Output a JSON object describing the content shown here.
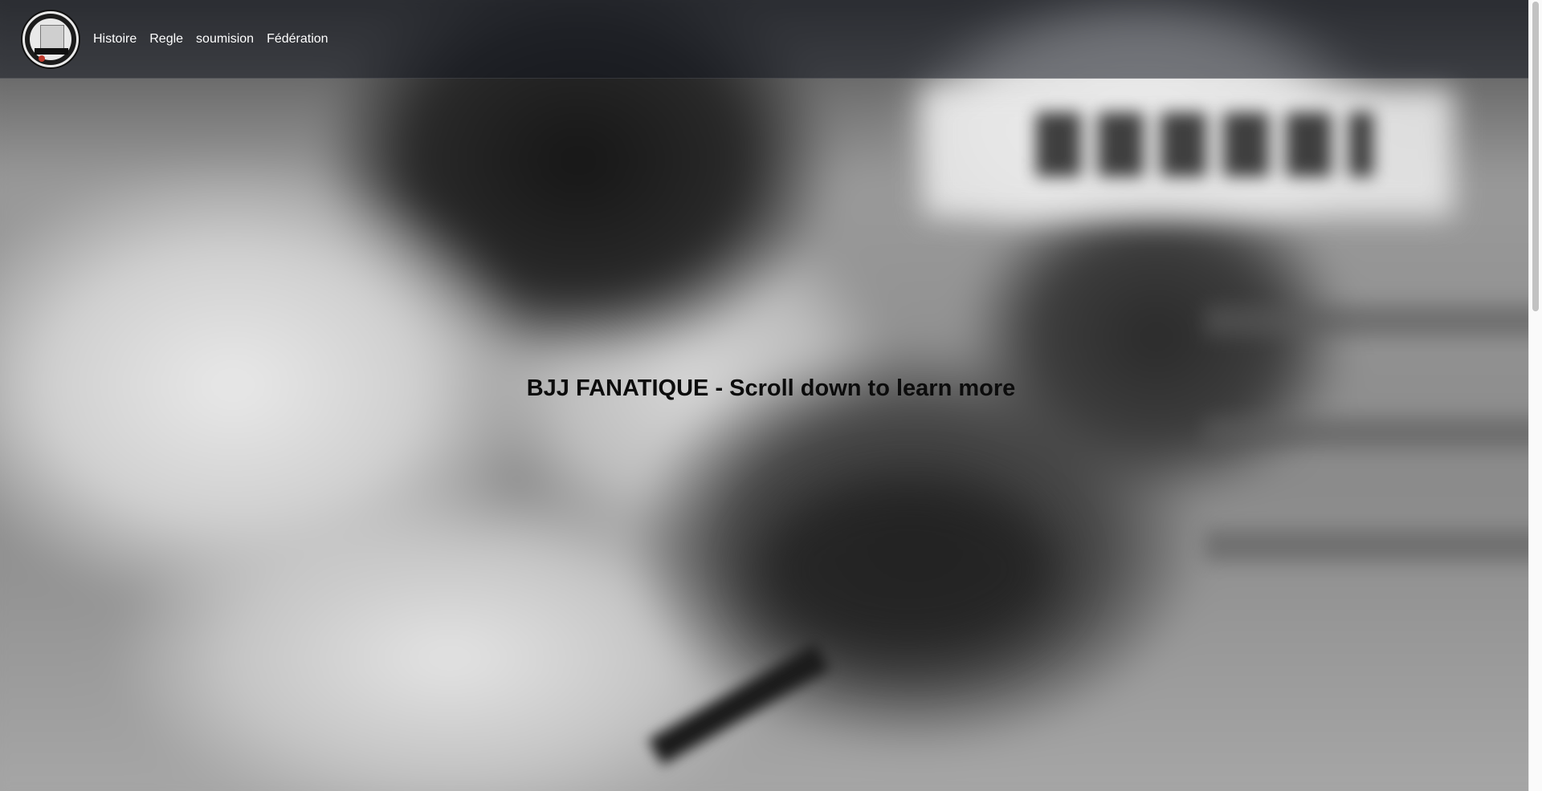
{
  "nav": {
    "logo_icon": "bjj-fanatique-logo-icon",
    "links": [
      {
        "label": "Histoire"
      },
      {
        "label": "Regle"
      },
      {
        "label": "soumision"
      },
      {
        "label": "Fédération"
      }
    ]
  },
  "hero": {
    "headline": "BJJ FANATIQUE - Scroll down to learn more",
    "background": "blurred grayscale jiu-jitsu photo"
  },
  "colors": {
    "navbar_bg": "#141820",
    "nav_text": "#ffffff",
    "headline_text": "#0c0c0c"
  }
}
